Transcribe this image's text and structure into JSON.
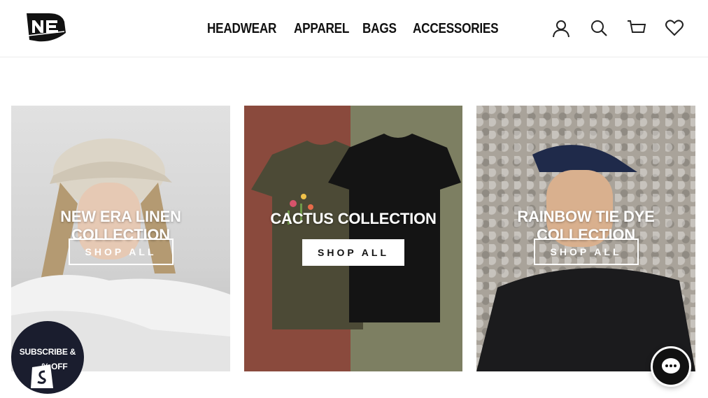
{
  "header": {
    "nav": [
      "HEADWEAR",
      "APPAREL",
      "BAGS",
      "ACCESSORIES"
    ],
    "icons": [
      "account-icon",
      "search-icon",
      "cart-icon",
      "wishlist-heart-icon"
    ]
  },
  "collections": [
    {
      "title": "NEW ERA LINEN COLLECTION",
      "button": "SHOP ALL"
    },
    {
      "title": "CACTUS COLLECTION",
      "button": "SHOP ALL"
    },
    {
      "title": "RAINBOW TIE DYE COLLECTION",
      "button": "SHOP ALL"
    }
  ],
  "subscribe": {
    "line1": "SUBSCRIBE &",
    "line2": "% OFF"
  },
  "colors": {
    "accent": "#111111",
    "subscribe_bg": "#1a1d2e",
    "card2_left": "#8a4a3d",
    "card2_right": "#7d7f62"
  }
}
